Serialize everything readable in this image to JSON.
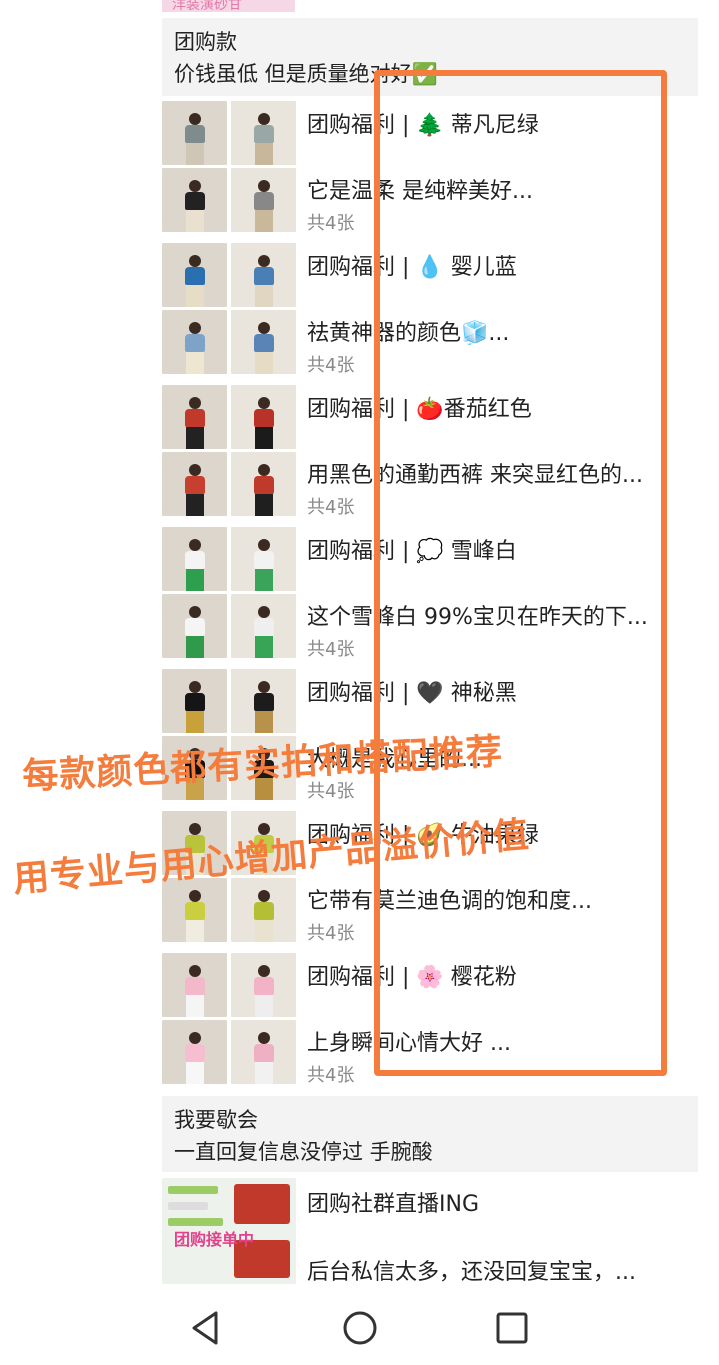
{
  "top_strip": {
    "text": "洋装演砂甘"
  },
  "section1": {
    "title": "团购款",
    "subtitle": "价钱虽低  但是质量绝对好✅"
  },
  "posts": [
    {
      "title": "团购福利 | 🌲 蒂凡尼绿",
      "body": "它是温柔 是纯粹美好...",
      "count": "共4张",
      "colors": [
        [
          "#7f8c8d",
          "#cfc6b5"
        ],
        [
          "#9aa7a7",
          "#c8b79a"
        ],
        [
          "#222",
          "#e9e0d0"
        ],
        [
          "#888",
          "#c9b99a"
        ]
      ]
    },
    {
      "title": "团购福利 | 💧 婴儿蓝",
      "body": "祛黄神器的颜色🧊...",
      "count": "共4张",
      "colors": [
        [
          "#2a6fb0",
          "#e7dcc6"
        ],
        [
          "#4a7fb5",
          "#e0d6c2"
        ],
        [
          "#7ea3c8",
          "#efe6d2"
        ],
        [
          "#5a84b6",
          "#e6dbc4"
        ]
      ]
    },
    {
      "title": "团购福利 | 🍅番茄红色",
      "body": "用黑色的通勤西裤 来突显红色的...",
      "count": "共4张",
      "colors": [
        [
          "#c0392b",
          "#222"
        ],
        [
          "#b83227",
          "#1b1b1b"
        ],
        [
          "#c7402f",
          "#222"
        ],
        [
          "#bf3a2a",
          "#1f1f1f"
        ]
      ]
    },
    {
      "title": "团购福利 | 💭 雪峰白",
      "body": "这个雪峰白  99%宝贝在昨天的下...",
      "count": "共4张",
      "colors": [
        [
          "#f4f4f4",
          "#2e9e4f"
        ],
        [
          "#f2f2f2",
          "#3aa55a"
        ],
        [
          "#f5f5f5",
          "#2f9a4c"
        ],
        [
          "#efefef",
          "#37a456"
        ]
      ]
    },
    {
      "title": "团购福利 | 🖤 神秘黑",
      "body": "大概是我心里的...",
      "count": "共4张",
      "colors": [
        [
          "#151515",
          "#c9a13a"
        ],
        [
          "#1c1c1c",
          "#b8914a"
        ],
        [
          "#111",
          "#caa24a"
        ],
        [
          "#1a1a1a",
          "#b88f3f"
        ]
      ]
    },
    {
      "title": "团购福利 | 🥑 牛油果绿",
      "body": "它带有莫兰迪色调的饱和度...",
      "count": "共4张",
      "colors": [
        [
          "#b9c43a",
          "#eae4d3"
        ],
        [
          "#c2cb45",
          "#e6dfcc"
        ],
        [
          "#c9cf3e",
          "#f0ece0"
        ],
        [
          "#b4bf35",
          "#e9e2cf"
        ]
      ]
    },
    {
      "title": "团购福利 | 🌸 樱花粉",
      "body": "上身瞬间心情大好 ...",
      "count": "共4张",
      "colors": [
        [
          "#f4b8cb",
          "#f5f5f5"
        ],
        [
          "#f2b3c7",
          "#eeeeee"
        ],
        [
          "#f6bfd0",
          "#f7f7f7"
        ],
        [
          "#efb0c4",
          "#f1f1f1"
        ]
      ]
    }
  ],
  "section2": {
    "title": "我要歇会",
    "subtitle": "一直回复信息没停过 手腕酸"
  },
  "post_live": {
    "title": "团购社群直播ING",
    "body": "后台私信太多，还没回复宝宝，...",
    "thumb_label": "团购接单中"
  },
  "overlay": {
    "line1": "每款颜色都有实拍和搭配推荐",
    "line2": "用专业与用心增加产品溢价价值"
  },
  "accent_color": "#f47c3c"
}
